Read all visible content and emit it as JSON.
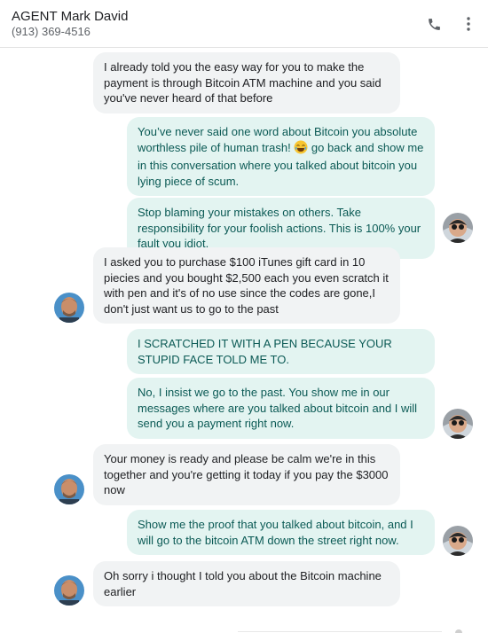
{
  "contact": {
    "name": "AGENT Mark David",
    "number": "(913) 369-4516"
  },
  "header": {
    "call_icon": "phone-icon",
    "menu_icon": "more-vert-icon"
  },
  "messages": [
    {
      "direction": "incoming",
      "text": "I already told you the easy way for you to make the payment is through Bitcoin ATM machine and you said you've never heard of that before"
    },
    {
      "direction": "outgoing",
      "text_before_emoji": "You’ve never said one word about Bitcoin you absolute worthless pile of human trash! ",
      "emoji": "😂",
      "text_after_emoji": " go back and show me in this conversation where you talked about bitcoin you lying piece of scum."
    },
    {
      "direction": "outgoing",
      "text": "Stop blaming your mistakes on others. Take responsibility for your foolish actions. This is 100% your fault you idiot."
    },
    {
      "direction": "incoming",
      "text": "I asked you to purchase $100 iTunes gift card in 10 piecies and you bought $2,500 each you even scratch it with pen and it's of no use since the codes are gone,I don't just want us to go to the past"
    },
    {
      "direction": "outgoing",
      "text": "I SCRATCHED IT WITH A PEN BECAUSE YOUR STUPID FACE TOLD ME TO."
    },
    {
      "direction": "outgoing",
      "text": "No, I insist we go to the past. You show me in our messages where are you talked about bitcoin and I will send you a payment right now."
    },
    {
      "direction": "incoming",
      "text": "Your money is ready and please be calm we're in this together and you're getting it today if you pay the $3000 now"
    },
    {
      "direction": "outgoing",
      "text": "Show me the proof that you talked about bitcoin, and I will go to the bitcoin ATM down the street right now."
    },
    {
      "direction": "incoming",
      "text": "Oh sorry i thought I told you about the Bitcoin machine earlier"
    }
  ],
  "colors": {
    "incoming_bubble": "#f1f3f4",
    "outgoing_bubble": "#e3f4f1",
    "outgoing_text": "#0b5a55"
  }
}
